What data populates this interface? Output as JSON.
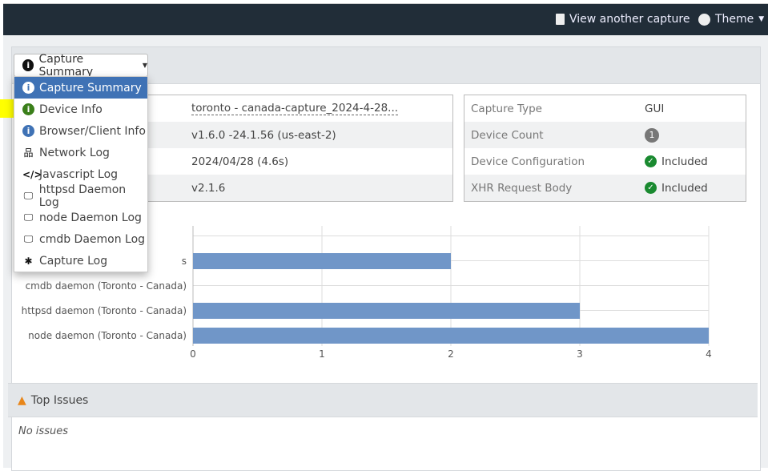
{
  "topbar": {
    "view_another": "View another capture",
    "theme": "Theme"
  },
  "dropdown": {
    "selected": "Capture Summary",
    "items": [
      {
        "label": "Capture Summary",
        "icon": "info-icon"
      },
      {
        "label": "Device Info",
        "icon": "info-icon"
      },
      {
        "label": "Browser/Client Info",
        "icon": "info-icon"
      },
      {
        "label": "Network Log",
        "icon": "network-icon"
      },
      {
        "label": "Javascript Log",
        "icon": "code-icon"
      },
      {
        "label": "httpsd Daemon Log",
        "icon": "desktop-icon"
      },
      {
        "label": "node Daemon Log",
        "icon": "desktop-icon"
      },
      {
        "label": "cmdb Daemon Log",
        "icon": "desktop-icon"
      },
      {
        "label": "Capture Log",
        "icon": "bug-icon"
      }
    ]
  },
  "left_table": {
    "values": [
      "toronto - canada-capture_2024-4-28...",
      "v1.6.0 -24.1.56 (us-east-2)",
      "2024/04/28 (4.6s)",
      "v2.1.6"
    ]
  },
  "right_table": {
    "rows": [
      {
        "key": "Capture Type",
        "value": "GUI"
      },
      {
        "key": "Device Count",
        "value": "1"
      },
      {
        "key": "Device Configuration",
        "value": "Included"
      },
      {
        "key": "XHR Request Body",
        "value": "Included"
      }
    ]
  },
  "chart_data": {
    "type": "bar",
    "orientation": "horizontal",
    "categories": [
      "s",
      "cmdb daemon (Toronto - Canada)",
      "httpsd daemon (Toronto - Canada)",
      "node daemon (Toronto - Canada)"
    ],
    "values": [
      2,
      0,
      3,
      4
    ],
    "xlim": [
      0,
      4
    ],
    "xticks": [
      "0",
      "1",
      "2",
      "3",
      "4"
    ],
    "color": "#7096c8"
  },
  "issues": {
    "title": "Top Issues",
    "empty": "No issues"
  }
}
